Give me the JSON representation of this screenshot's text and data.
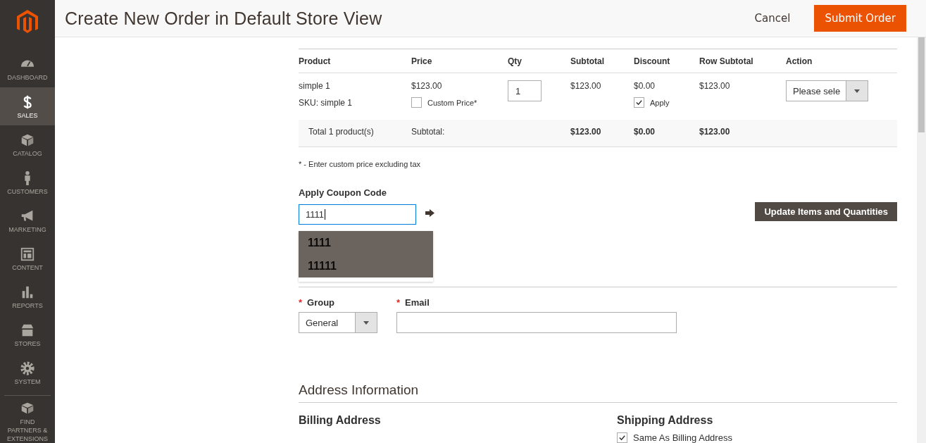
{
  "sidebar": {
    "items": [
      {
        "label": "DASHBOARD",
        "selected": false
      },
      {
        "label": "SALES",
        "selected": true
      },
      {
        "label": "CATALOG",
        "selected": false
      },
      {
        "label": "CUSTOMERS",
        "selected": false
      },
      {
        "label": "MARKETING",
        "selected": false
      },
      {
        "label": "CONTENT",
        "selected": false
      },
      {
        "label": "REPORTS",
        "selected": false
      },
      {
        "label": "STORES",
        "selected": false
      },
      {
        "label": "SYSTEM",
        "selected": false
      },
      {
        "label": "FIND PARTNERS & EXTENSIONS",
        "selected": false
      }
    ]
  },
  "header": {
    "title": "Create New Order in Default Store View",
    "cancel": "Cancel",
    "submit": "Submit Order"
  },
  "items_table": {
    "columns": [
      "Product",
      "Price",
      "Qty",
      "Subtotal",
      "Discount",
      "Row Subtotal",
      "Action"
    ],
    "rows": [
      {
        "product": "simple 1",
        "sku": "SKU: simple 1",
        "price": "$123.00",
        "custom_price": {
          "label": "Custom Price*",
          "checked": false
        },
        "qty": "1",
        "subtotal": "$123.00",
        "discount": "$0.00",
        "apply": {
          "label": "Apply",
          "checked": true
        },
        "row_subtotal": "$123.00",
        "action": "Please sele"
      }
    ],
    "totals": {
      "label": "Total 1 product(s)",
      "subtotal_label": "Subtotal:",
      "subtotal": "$123.00",
      "discount": "$0.00",
      "row_subtotal": "$123.00"
    }
  },
  "note": "* - Enter custom price excluding tax",
  "coupon": {
    "label": "Apply Coupon Code",
    "value": "1111",
    "suggestions": [
      "1111",
      "11111"
    ]
  },
  "update_button": "Update Items and Quantities",
  "account": {
    "group": {
      "label": "Group",
      "required_mark": "*",
      "value": "General"
    },
    "email": {
      "label": "Email",
      "required_mark": "*"
    }
  },
  "address": {
    "title": "Address Information",
    "billing": "Billing Address",
    "shipping": "Shipping Address",
    "same_as_billing": {
      "label": "Same As Billing Address",
      "checked": true
    }
  }
}
